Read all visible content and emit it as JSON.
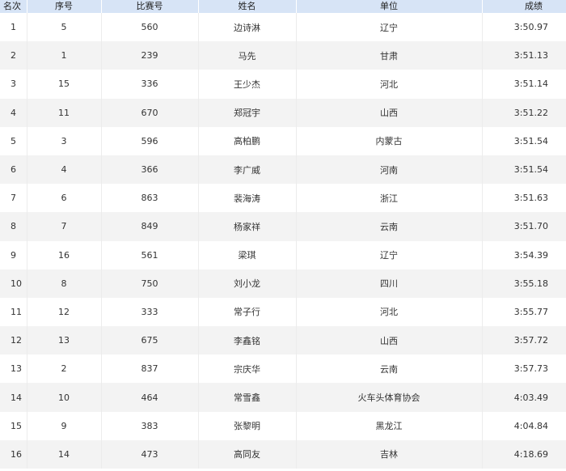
{
  "table": {
    "headers": {
      "rank": "名次",
      "seq": "序号",
      "bib": "比赛号",
      "name": "姓名",
      "unit": "单位",
      "time": "成绩"
    },
    "rows": [
      {
        "rank": "1",
        "seq": "5",
        "bib": "560",
        "name": "边诗淋",
        "unit": "辽宁",
        "time": "3:50.97"
      },
      {
        "rank": "2",
        "seq": "1",
        "bib": "239",
        "name": "马先",
        "unit": "甘肃",
        "time": "3:51.13"
      },
      {
        "rank": "3",
        "seq": "15",
        "bib": "336",
        "name": "王少杰",
        "unit": "河北",
        "time": "3:51.14"
      },
      {
        "rank": "4",
        "seq": "11",
        "bib": "670",
        "name": "郑冠宇",
        "unit": "山西",
        "time": "3:51.22"
      },
      {
        "rank": "5",
        "seq": "3",
        "bib": "596",
        "name": "高柏鹏",
        "unit": "内蒙古",
        "time": "3:51.54"
      },
      {
        "rank": "6",
        "seq": "4",
        "bib": "366",
        "name": "李广威",
        "unit": "河南",
        "time": "3:51.54"
      },
      {
        "rank": "7",
        "seq": "6",
        "bib": "863",
        "name": "裴海涛",
        "unit": "浙江",
        "time": "3:51.63"
      },
      {
        "rank": "8",
        "seq": "7",
        "bib": "849",
        "name": "杨家祥",
        "unit": "云南",
        "time": "3:51.70"
      },
      {
        "rank": "9",
        "seq": "16",
        "bib": "561",
        "name": "梁琪",
        "unit": "辽宁",
        "time": "3:54.39"
      },
      {
        "rank": "10",
        "seq": "8",
        "bib": "750",
        "name": "刘小龙",
        "unit": "四川",
        "time": "3:55.18"
      },
      {
        "rank": "11",
        "seq": "12",
        "bib": "333",
        "name": "常子行",
        "unit": "河北",
        "time": "3:55.77"
      },
      {
        "rank": "12",
        "seq": "13",
        "bib": "675",
        "name": "李鑫铭",
        "unit": "山西",
        "time": "3:57.72"
      },
      {
        "rank": "13",
        "seq": "2",
        "bib": "837",
        "name": "宗庆华",
        "unit": "云南",
        "time": "3:57.73"
      },
      {
        "rank": "14",
        "seq": "10",
        "bib": "464",
        "name": "常雪鑫",
        "unit": "火车头体育协会",
        "time": "4:03.49"
      },
      {
        "rank": "15",
        "seq": "9",
        "bib": "383",
        "name": "张黎明",
        "unit": "黑龙江",
        "time": "4:04.84"
      },
      {
        "rank": "16",
        "seq": "14",
        "bib": "473",
        "name": "高同友",
        "unit": "吉林",
        "time": "4:18.69"
      }
    ]
  }
}
